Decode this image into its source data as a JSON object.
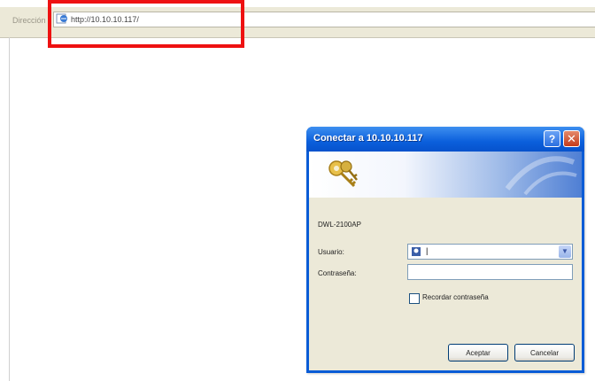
{
  "address_bar": {
    "label": "Dirección",
    "url": "http://10.10.10.117/"
  },
  "dialog": {
    "title": "Conectar a 10.10.10.117",
    "help_glyph": "?",
    "close_glyph": "✕",
    "realm": "DWL-2100AP",
    "username_label": "Usuario:",
    "username_value": "|",
    "password_label": "Contraseña:",
    "password_value": "",
    "remember_label": "Recordar contraseña",
    "remember_checked": false,
    "ok_label": "Aceptar",
    "cancel_label": "Cancelar"
  },
  "colors": {
    "highlight": "#ee1111",
    "titlebar": "#0b5fdc",
    "dialog_body": "#ece9d8"
  }
}
